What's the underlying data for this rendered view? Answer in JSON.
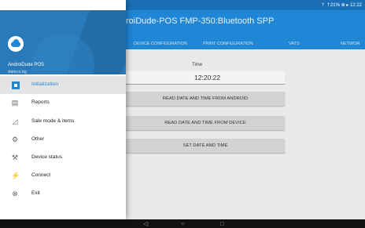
{
  "status_bar": {
    "left_icons": "▴ ▸ ⇡",
    "right_text": "⇡ ⇡21% ⊕ ▸ 12:22"
  },
  "app": {
    "title": "roiDude-POS   FMP-350:Bluetooth SPP"
  },
  "tabs": [
    {
      "label": "DEVICE CONFIGURATION",
      "active": false
    },
    {
      "label": "PRINT CONFIGURATION",
      "active": false
    },
    {
      "label": "VATS",
      "active": false
    },
    {
      "label": "NETWOR",
      "active": false
    }
  ],
  "content": {
    "time_label": "Time",
    "time_value": "12:20:22",
    "buttons": [
      {
        "label": "READ DATE AND TIME FROM ANDROID"
      },
      {
        "label": "READ DATE AND TIME FROM DEVICE"
      },
      {
        "label": "SET DATE AND TIME"
      }
    ]
  },
  "drawer": {
    "name": "AndroiDude POS",
    "subtitle": "datecs.bg",
    "items": [
      {
        "label": "Initialization",
        "icon": "initialization-icon",
        "active": true
      },
      {
        "label": "Reports",
        "icon": "reports-icon",
        "active": false
      },
      {
        "label": "Sale mode & items",
        "icon": "cart-icon",
        "active": false
      },
      {
        "label": "Other",
        "icon": "gears-icon",
        "active": false
      },
      {
        "label": "Device status",
        "icon": "wrench-icon",
        "active": false
      },
      {
        "label": "Connect",
        "icon": "plug-icon",
        "active": false
      },
      {
        "label": "Exit",
        "icon": "close-circle-icon",
        "active": false
      }
    ]
  },
  "nav_bar": {
    "back": "◁",
    "home": "○",
    "recents": "□"
  },
  "colors": {
    "primary": "#2086d6",
    "header": "#2a7ab9",
    "status_bar": "#1a6fb6"
  }
}
